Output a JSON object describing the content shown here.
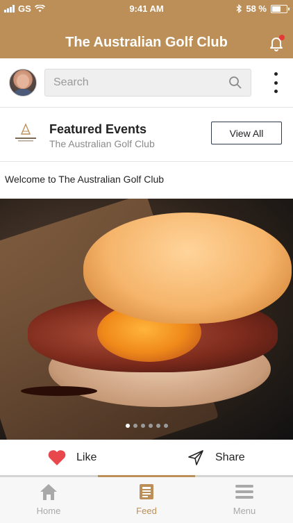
{
  "status": {
    "carrier": "GS",
    "time": "9:41 AM",
    "battery": "58 %",
    "battery_level": 0.58
  },
  "header": {
    "title": "The Australian Golf Club",
    "notification_icon": "bell-icon",
    "has_notification": true
  },
  "search": {
    "placeholder": "Search",
    "icon": "search-icon"
  },
  "featured": {
    "title": "Featured Events",
    "subtitle": "The Australian Golf Club",
    "view_all": "View All",
    "logo_text": "THE AUSTRALIAN"
  },
  "post": {
    "text": "Welcome to The Australian Golf Club",
    "carousel_total": 6,
    "carousel_active": 1
  },
  "actions": {
    "like": "Like",
    "share": "Share"
  },
  "tabs": [
    {
      "label": "Home",
      "icon": "home-icon"
    },
    {
      "label": "Feed",
      "icon": "feed-icon"
    },
    {
      "label": "Menu",
      "icon": "menu-icon"
    }
  ],
  "colors": {
    "brand": "#bd8f58",
    "like": "#e8474c"
  }
}
